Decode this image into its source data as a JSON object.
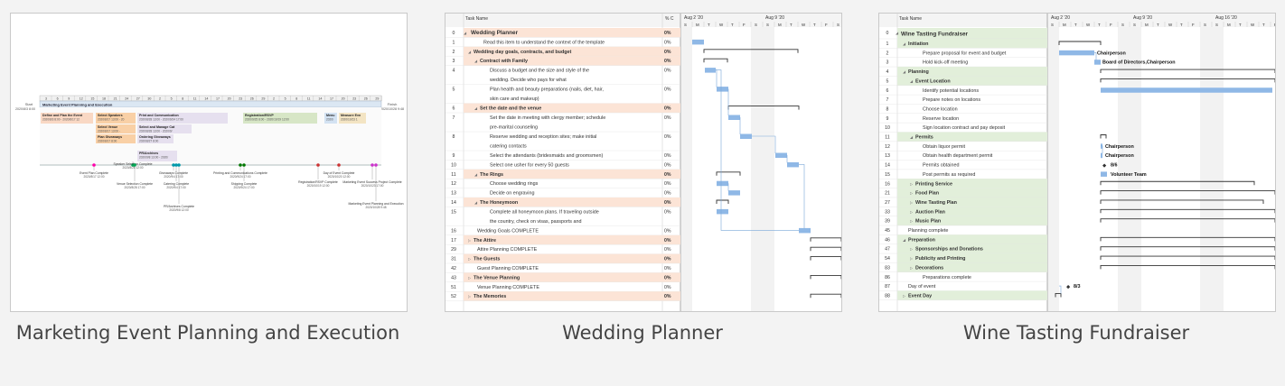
{
  "templates": [
    {
      "caption": "Marketing Event Planning and Execution",
      "start_label": "Start",
      "start_date": "2020/8/3 8:00",
      "finish_label": "Finish",
      "finish_date": "2020/10/28 9:48",
      "scale_days": [
        "3",
        "6",
        "9",
        "12",
        "15",
        "18",
        "21",
        "24",
        "27",
        "30",
        "2",
        "5",
        "8",
        "11",
        "14",
        "17",
        "20",
        "23",
        "26",
        "29",
        "2",
        "5",
        "8",
        "11",
        "14",
        "17",
        "20",
        "23",
        "26",
        "29"
      ],
      "header_bar": "Marketing Event Planning and Execution",
      "boxes": [
        {
          "title": "Define and Plan the Event",
          "dates": "2020/8/3 8:00 - 2020/8/17 12"
        },
        {
          "title": "Select Speakers",
          "dates": "2020/8/17 13:00 - 20"
        },
        {
          "title": "Print and Communication",
          "dates": "2020/8/28 13:00 - 2020/9/24 17:00"
        },
        {
          "title": "Registration/RSVP",
          "dates": "2020/9/25 8:00 - 2020/10/19 12:00"
        },
        {
          "title": "Menu",
          "dates": "2020/"
        },
        {
          "title": "Measure Evn",
          "dates": "2020/10/23 1"
        },
        {
          "title": "Select Venue",
          "dates": "2020/8/17 13:00 -"
        },
        {
          "title": "Select and Manage Cat",
          "dates": "2020/8/28 13:00 - 2020/9/"
        },
        {
          "title": "Plan Giveaways",
          "dates": "2020/8/17 8:00"
        },
        {
          "title": "Ordering Giveaways",
          "dates": "2020/8/27 8:00"
        },
        {
          "title": "PR/Archives",
          "dates": "2020/9/8 13:00 - 2020/"
        }
      ],
      "milestones": [
        {
          "name": "Event Plan Complete",
          "date": "2020/8/17 12:00"
        },
        {
          "name": "Speaker Selection Complete",
          "date": "2020/8/28 12:00"
        },
        {
          "name": "Venue Selection Complete",
          "date": "2020/8/28 17:00"
        },
        {
          "name": "Giveaways Complete",
          "date": "2020/9/4 17:00"
        },
        {
          "name": "Catering Complete",
          "date": "2020/9/4 17:00"
        },
        {
          "name": "PR/Archives Complete",
          "date": "2020/9/8 12:00"
        },
        {
          "name": "Printing and Communications Complete",
          "date": "2020/9/24 17:00"
        },
        {
          "name": "Shipping Complete",
          "date": "2020/9/24 17:00"
        },
        {
          "name": "Registration/RSVP Complete",
          "date": "2020/10/19 12:00"
        },
        {
          "name": "Day of Event Complete",
          "date": "2020/10/20 12:00"
        },
        {
          "name": "Marketing Event Success Project Complete",
          "date": "2020/10/23 17:00"
        },
        {
          "name": "Marketing Event Planning and Execution",
          "date": "2020/10/28 9:48"
        }
      ]
    },
    {
      "caption": "Wedding Planner",
      "col_task": "Task Name",
      "col_pct": "% C",
      "week1": "Aug 2 '20",
      "week2": "Aug 9 '20",
      "days": [
        "S",
        "M",
        "T",
        "W",
        "T",
        "F",
        "S",
        "S",
        "M",
        "T",
        "W",
        "T",
        "F",
        "S"
      ],
      "rows": [
        {
          "id": "0",
          "name": "Wedding Planner",
          "pct": "0%"
        },
        {
          "id": "1",
          "name": "Read this item to understand the context of the template",
          "pct": "0%"
        },
        {
          "id": "2",
          "name": "Wedding day goals, contracts, and budget",
          "pct": "0%"
        },
        {
          "id": "3",
          "name": "Contract with Family",
          "pct": "0%"
        },
        {
          "id": "4",
          "name": "Discuss a budget and the size and style of the",
          "name2": "wedding. Decide who pays for what",
          "pct": "0%"
        },
        {
          "id": "5",
          "name": "Plan health and beauty preparations (nails, diet, hair,",
          "name2": "skin care and makeup)",
          "pct": "0%"
        },
        {
          "id": "6",
          "name": "Set the date and the venue",
          "pct": "0%"
        },
        {
          "id": "7",
          "name": "Set the date in meeting with clergy member; schedule",
          "name2": "pre-marital counseling",
          "pct": "0%"
        },
        {
          "id": "8",
          "name": "Reserve wedding and reception sites; make initial",
          "name2": "catering contacts",
          "pct": "0%"
        },
        {
          "id": "9",
          "name": "Select the attendants (bridesmaids and groomsmen)",
          "pct": "0%"
        },
        {
          "id": "10",
          "name": "Select one usher for every 50 guests",
          "pct": "0%"
        },
        {
          "id": "11",
          "name": "The Rings",
          "pct": "0%"
        },
        {
          "id": "12",
          "name": "Choose wedding rings",
          "pct": "0%"
        },
        {
          "id": "13",
          "name": "Decide on engraving",
          "pct": "0%"
        },
        {
          "id": "14",
          "name": "The Honeymoon",
          "pct": "0%"
        },
        {
          "id": "15",
          "name": "Complete all honeymoon plans. If traveling outside",
          "name2": "the country, check on visas, passports and",
          "pct": "0%"
        },
        {
          "id": "16",
          "name": "Wedding Goals COMPLETE",
          "pct": "0%"
        },
        {
          "id": "17",
          "name": "The Attire",
          "pct": "0%"
        },
        {
          "id": "29",
          "name": "Attire Planning COMPLETE",
          "pct": "0%"
        },
        {
          "id": "31",
          "name": "The Guests",
          "pct": "0%"
        },
        {
          "id": "42",
          "name": "Guest Planning COMPLETE",
          "pct": "0%"
        },
        {
          "id": "43",
          "name": "The Venue Planning",
          "pct": "0%"
        },
        {
          "id": "51",
          "name": "Venue Planning COMPLETE",
          "pct": "0%"
        },
        {
          "id": "52",
          "name": "The Memories",
          "pct": "0%"
        }
      ]
    },
    {
      "caption": "Wine Tasting Fundraiser",
      "col_task": "Task Name",
      "week1": "Aug 2 '20",
      "week2": "Aug 9 '20",
      "week3": "Aug 16 '20",
      "days": [
        "S",
        "M",
        "T",
        "W",
        "T",
        "F",
        "S",
        "S",
        "M",
        "T",
        "W",
        "T",
        "F",
        "S",
        "S",
        "M",
        "T",
        "W",
        "T",
        "F",
        "S"
      ],
      "rows": [
        {
          "id": "0",
          "name": "Wine Tasting Fundraiser"
        },
        {
          "id": "1",
          "name": "Initiation"
        },
        {
          "id": "2",
          "name": "Prepare proposal for event and budget"
        },
        {
          "id": "3",
          "name": "Hold kick-off meeting"
        },
        {
          "id": "4",
          "name": "Planning"
        },
        {
          "id": "5",
          "name": "Event Location"
        },
        {
          "id": "6",
          "name": "Identify potential locations"
        },
        {
          "id": "7",
          "name": "Prepare notes on locations"
        },
        {
          "id": "8",
          "name": "Choose location"
        },
        {
          "id": "9",
          "name": "Reserve location"
        },
        {
          "id": "10",
          "name": "Sign location contract and pay deposit"
        },
        {
          "id": "11",
          "name": "Permits"
        },
        {
          "id": "12",
          "name": "Obtain liquor permit"
        },
        {
          "id": "13",
          "name": "Obtain health department permit"
        },
        {
          "id": "14",
          "name": "Permits obtained"
        },
        {
          "id": "15",
          "name": "Post permits as required"
        },
        {
          "id": "16",
          "name": "Printing Service"
        },
        {
          "id": "21",
          "name": "Food Plan"
        },
        {
          "id": "27",
          "name": "Wine Tasting Plan"
        },
        {
          "id": "33",
          "name": "Auction Plan"
        },
        {
          "id": "39",
          "name": "Music Plan"
        },
        {
          "id": "45",
          "name": "Planning complete"
        },
        {
          "id": "46",
          "name": "Preparation"
        },
        {
          "id": "47",
          "name": "Sponsorships and Donations"
        },
        {
          "id": "54",
          "name": "Publicity and Printing"
        },
        {
          "id": "83",
          "name": "Decorations"
        },
        {
          "id": "86",
          "name": "Preparations complete"
        },
        {
          "id": "87",
          "name": "Day of event"
        },
        {
          "id": "88",
          "name": "Event Day"
        }
      ],
      "bar_labels": {
        "r2": "Chairperson",
        "r3": "Board of Directors,Chairperson",
        "r12": "Chairperson",
        "r13": "Chairperson",
        "r14": "8/6",
        "r15": "Volunteer Team",
        "r87": "8/3"
      }
    }
  ]
}
